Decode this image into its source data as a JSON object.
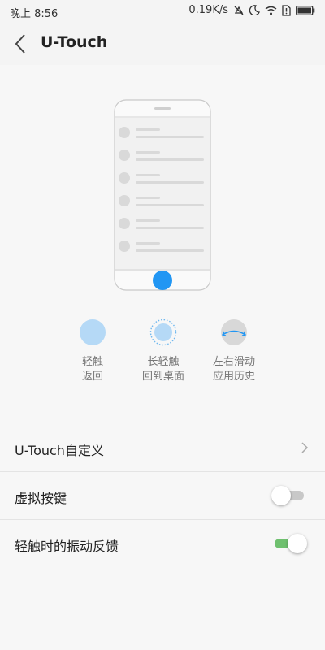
{
  "status_bar": {
    "time": "晚上 8:56",
    "network_speed": "0.19K/s",
    "icons": [
      "silent-icon",
      "moon-icon",
      "wifi-icon",
      "sim-alert-icon",
      "battery-icon"
    ]
  },
  "header": {
    "title": "U-Touch",
    "back_icon": "back-arrow-icon"
  },
  "gestures": [
    {
      "icon": "tap-circle-icon",
      "line1": "轻触",
      "line2": "返回"
    },
    {
      "icon": "long-press-circle-icon",
      "line1": "长轻触",
      "line2": "回到桌面"
    },
    {
      "icon": "swipe-circle-icon",
      "line1": "左右滑动",
      "line2": "应用历史"
    }
  ],
  "settings": [
    {
      "label": "U-Touch自定义",
      "type": "link"
    },
    {
      "label": "虚拟按键",
      "type": "toggle",
      "on": false
    },
    {
      "label": "轻触时的振动反馈",
      "type": "toggle",
      "on": true
    }
  ],
  "colors": {
    "accent_blue": "#2196f3",
    "light_blue": "#b5d9f6",
    "toggle_on": "#6fc06f",
    "toggle_off": "#c8c8c8"
  }
}
